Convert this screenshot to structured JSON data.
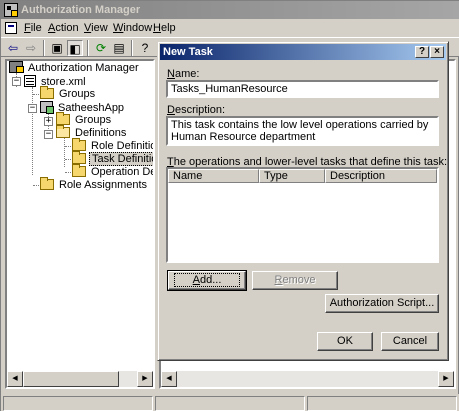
{
  "main_window": {
    "title": "Authorization Manager"
  },
  "menu": {
    "file": {
      "ul": "F",
      "rest": "ile"
    },
    "action": {
      "ul": "A",
      "rest": "ction"
    },
    "view": {
      "ul": "V",
      "rest": "iew"
    },
    "window": {
      "ul": "W",
      "rest": "indow"
    },
    "help": {
      "ul": "H",
      "rest": "elp"
    }
  },
  "toolbar": {
    "icons": [
      "back-arrow-icon",
      "forward-arrow-icon",
      "up-folder-icon",
      "show-hide-tree-icon",
      "refresh-icon",
      "export-list-icon",
      "help-icon"
    ]
  },
  "tree": {
    "root": "Authorization Manager",
    "store": "store.xml",
    "store_groups": "Groups",
    "app": "SatheeshApp",
    "app_groups": "Groups",
    "definitions": "Definitions",
    "role_definitions": "Role Definitions",
    "task_definitions": "Task Definitions",
    "operation_definitions": "Operation Definitions",
    "role_assignments": "Role Assignments"
  },
  "dialog": {
    "title": "New Task",
    "help_btn": "?",
    "close_btn": "×",
    "name_label": {
      "ul": "N",
      "rest": "ame:"
    },
    "name_value": "Tasks_HumanResource",
    "description_label": {
      "ul": "D",
      "rest": "escription:"
    },
    "description_value": "This task contains the low level operations carried by Human Resource department",
    "operations_label": {
      "ul": "T",
      "rest": "he operations and lower-level tasks that define this task:"
    },
    "columns": [
      "Name",
      "Type",
      "Description"
    ],
    "add_button": {
      "ul": "A",
      "rest": "dd..."
    },
    "remove_button": {
      "ul": "R",
      "rest": "emove"
    },
    "auth_script_button": "Authorization Script...",
    "ok_button": "OK",
    "cancel_button": "Cancel"
  },
  "colors": {
    "dialog_title_start": "#0a246a",
    "dialog_title_end": "#a6caf0",
    "inactive_title": "#808080",
    "face": "#d4d0c8"
  }
}
